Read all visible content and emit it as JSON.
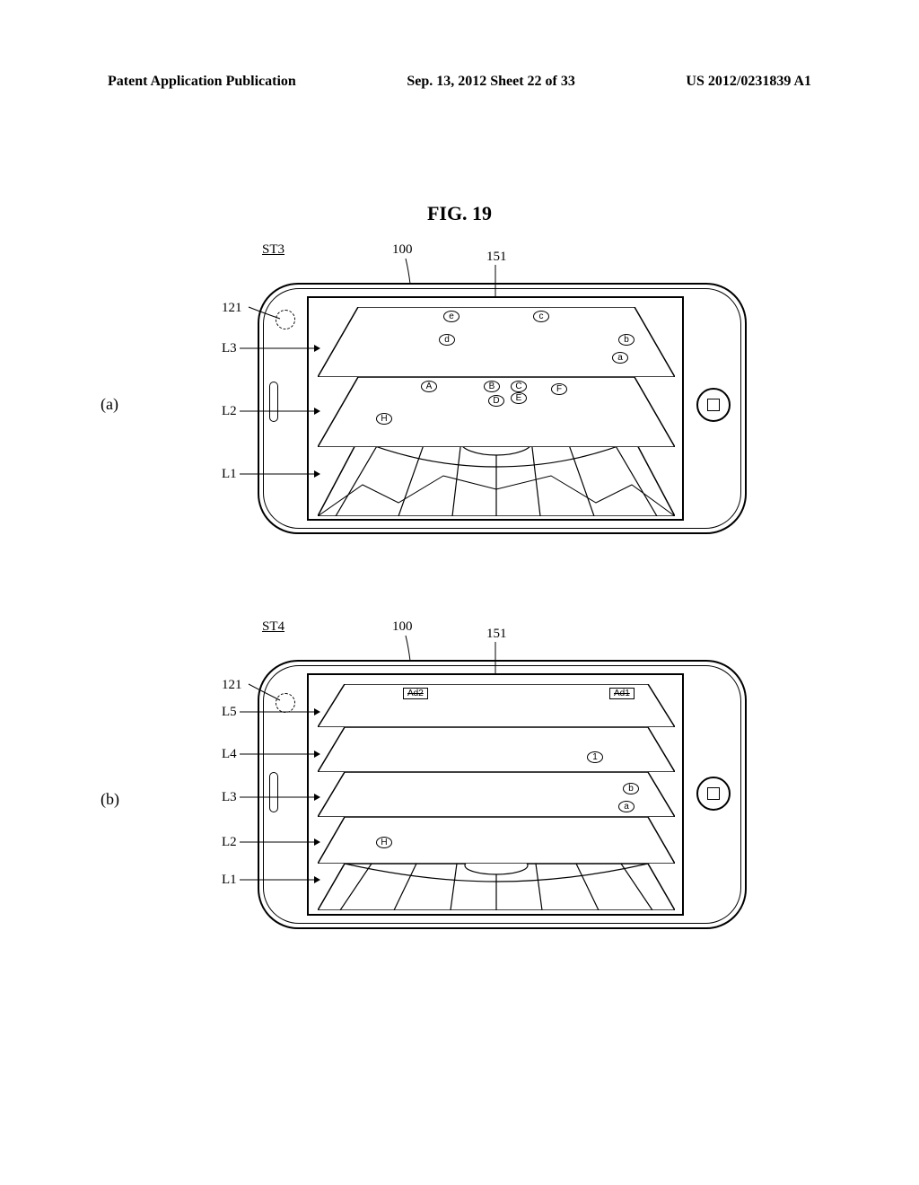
{
  "header": {
    "left": "Patent Application Publication",
    "center": "Sep. 13, 2012  Sheet 22 of 33",
    "right": "US 2012/0231839 A1"
  },
  "figure_title": "FIG. 19",
  "diagram_a": {
    "sub": "(a)",
    "st": "ST3",
    "ref_100": "100",
    "ref_151": "151",
    "ref_121": "121",
    "L1": "L1",
    "L2": "L2",
    "L3": "L3",
    "letters_L3": [
      "e",
      "c",
      "d",
      "b",
      "a"
    ],
    "letters_L2": [
      "A",
      "B",
      "C",
      "D",
      "E",
      "F",
      "H"
    ]
  },
  "diagram_b": {
    "sub": "(b)",
    "st": "ST4",
    "ref_100": "100",
    "ref_151": "151",
    "ref_121": "121",
    "L1": "L1",
    "L2": "L2",
    "L3": "L3",
    "L4": "L4",
    "L5": "L5",
    "ads": [
      "Ad2",
      "Ad1"
    ],
    "letter_L4": "1",
    "letters_L3": [
      "b",
      "a"
    ],
    "letter_L2": "H"
  }
}
